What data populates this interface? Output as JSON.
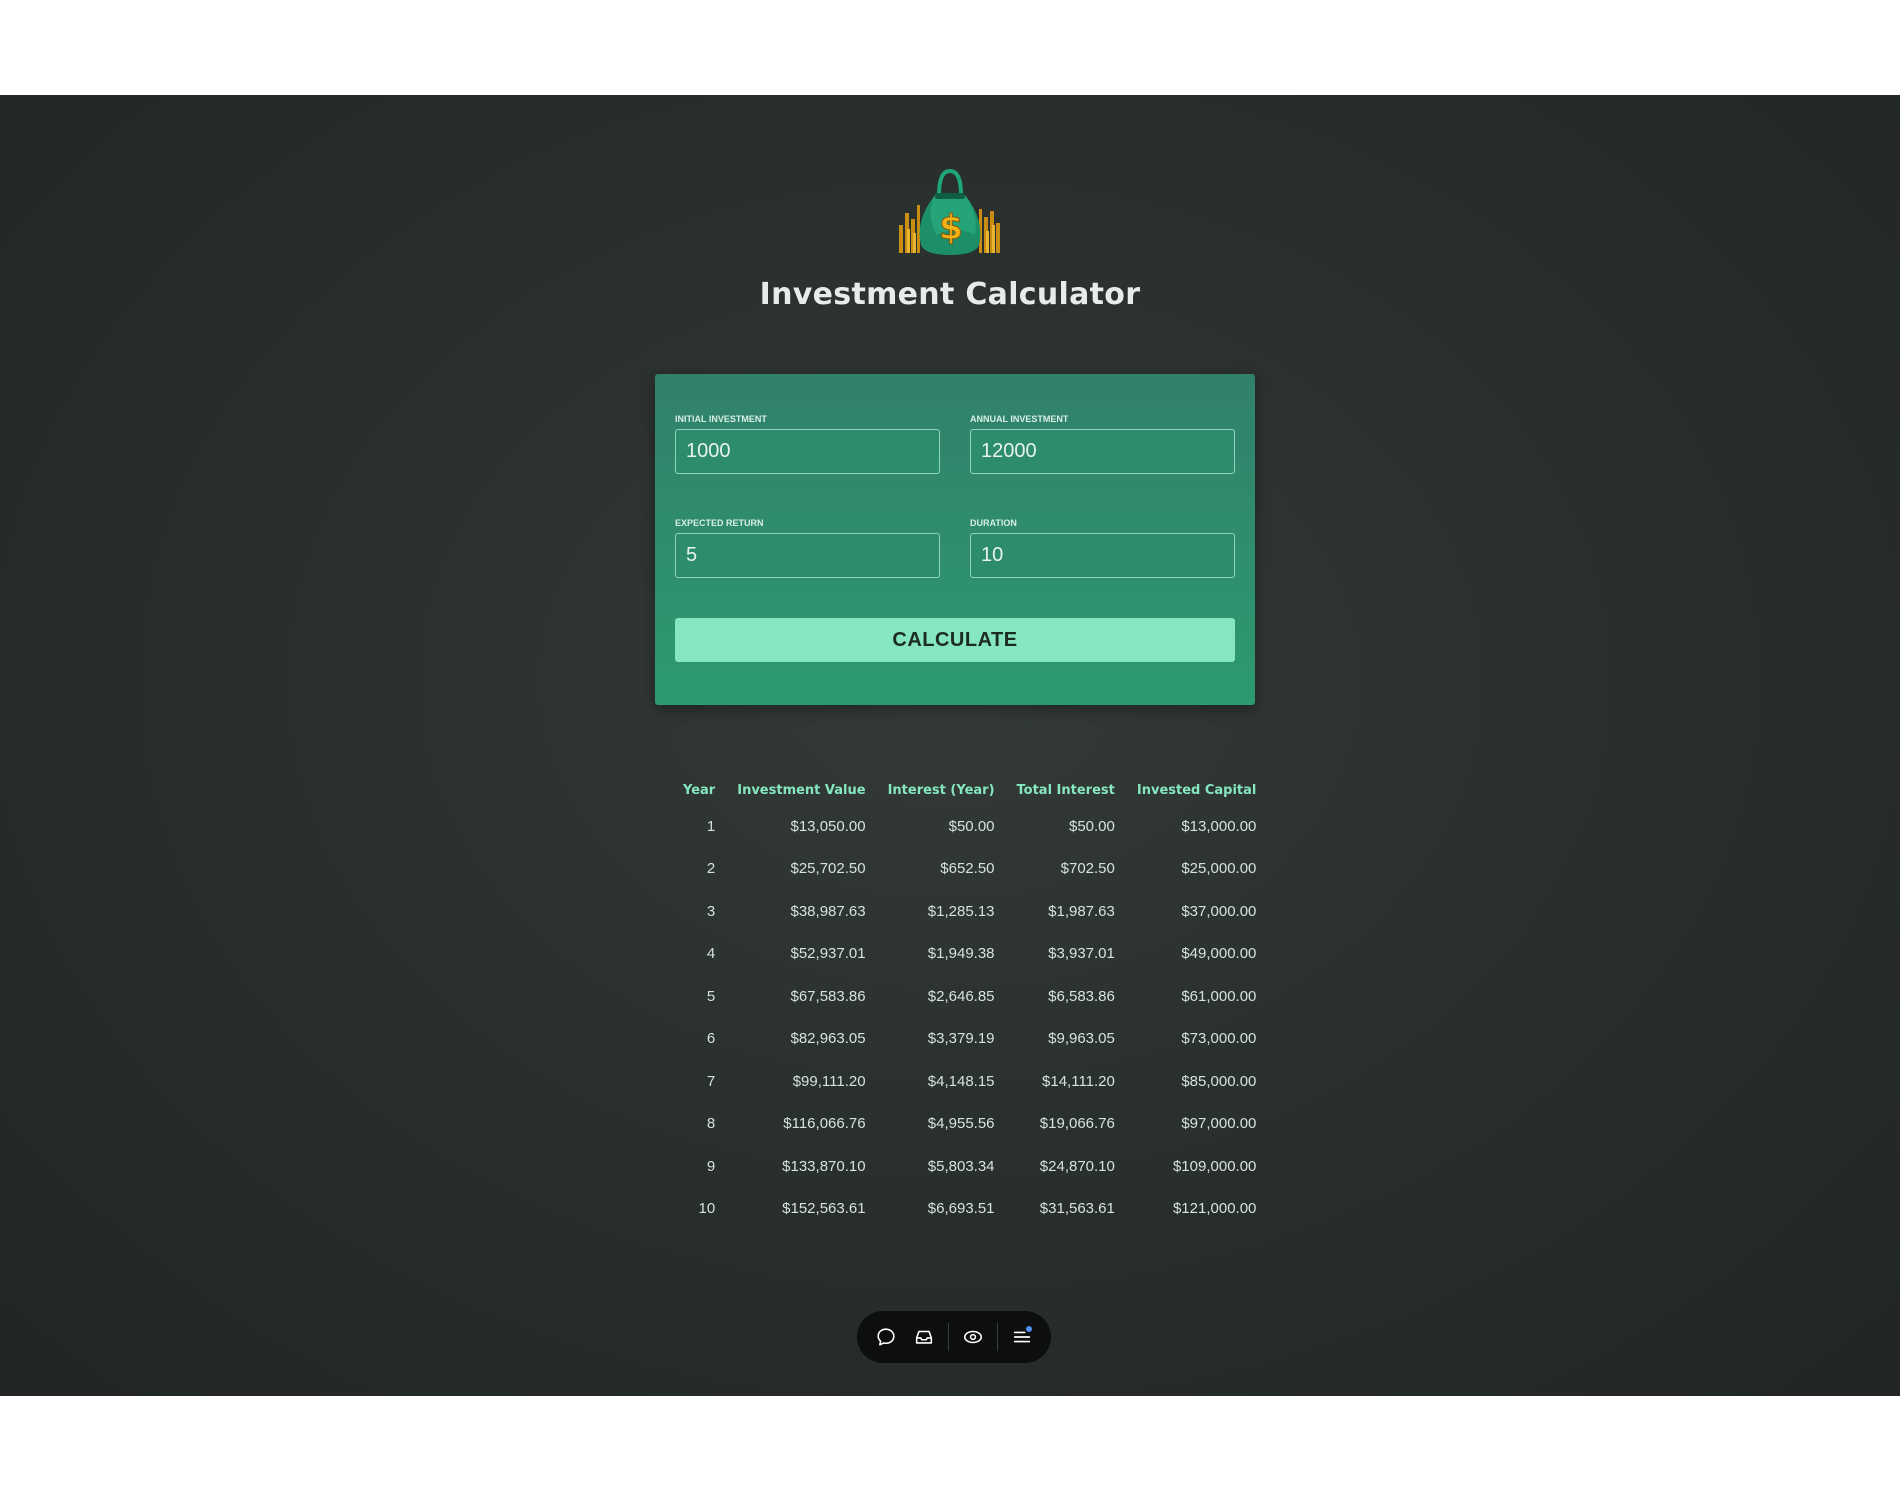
{
  "header": {
    "title": "Investment Calculator",
    "logo_icon": "money-bag-dollar-icon"
  },
  "form": {
    "initial_investment": {
      "label": "INITIAL INVESTMENT",
      "value": "1000"
    },
    "annual_investment": {
      "label": "ANNUAL INVESTMENT",
      "value": "12000"
    },
    "expected_return": {
      "label": "EXPECTED RETURN",
      "value": "5"
    },
    "duration": {
      "label": "DURATION",
      "value": "10"
    },
    "calculate_label": "CALCULATE"
  },
  "table": {
    "headers": [
      "Year",
      "Investment Value",
      "Interest (Year)",
      "Total Interest",
      "Invested Capital"
    ],
    "rows": [
      [
        "1",
        "$13,050.00",
        "$50.00",
        "$50.00",
        "$13,000.00"
      ],
      [
        "2",
        "$25,702.50",
        "$652.50",
        "$702.50",
        "$25,000.00"
      ],
      [
        "3",
        "$38,987.63",
        "$1,285.13",
        "$1,987.63",
        "$37,000.00"
      ],
      [
        "4",
        "$52,937.01",
        "$1,949.38",
        "$3,937.01",
        "$49,000.00"
      ],
      [
        "5",
        "$67,583.86",
        "$2,646.85",
        "$6,583.86",
        "$61,000.00"
      ],
      [
        "6",
        "$82,963.05",
        "$3,379.19",
        "$9,963.05",
        "$73,000.00"
      ],
      [
        "7",
        "$99,111.20",
        "$4,148.15",
        "$14,111.20",
        "$85,000.00"
      ],
      [
        "8",
        "$116,066.76",
        "$4,955.56",
        "$19,066.76",
        "$97,000.00"
      ],
      [
        "9",
        "$133,870.10",
        "$5,803.34",
        "$24,870.10",
        "$109,000.00"
      ],
      [
        "10",
        "$152,563.61",
        "$6,693.51",
        "$31,563.61",
        "$121,000.00"
      ]
    ]
  },
  "toolbar": {
    "icons": [
      "chat-bubble-icon",
      "inbox-tray-icon",
      "eye-icon",
      "menu-lines-icon"
    ],
    "notification_color": "#4e8ff5"
  },
  "colors": {
    "accent": "#86e6c0",
    "card": "#2d9a6f",
    "background": "#2a302e"
  }
}
